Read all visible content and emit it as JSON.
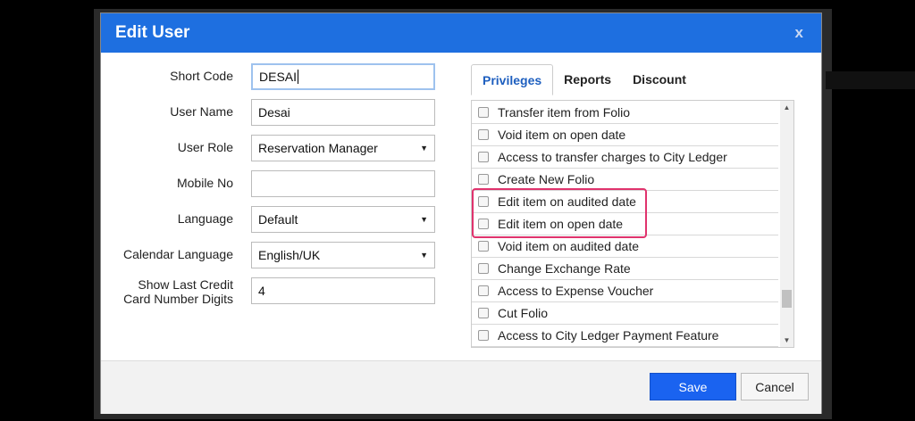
{
  "modal": {
    "title": "Edit User",
    "close_label": "x"
  },
  "form": {
    "short_code": {
      "label": "Short Code",
      "value": "DESAI"
    },
    "user_name": {
      "label": "User Name",
      "value": "Desai"
    },
    "user_role": {
      "label": "User Role",
      "value": "Reservation Manager"
    },
    "mobile_no": {
      "label": "Mobile No",
      "value": ""
    },
    "language": {
      "label": "Language",
      "value": "Default"
    },
    "calendar_language": {
      "label": "Calendar Language",
      "value": "English/UK"
    },
    "show_last_digits": {
      "label_line1": "Show Last Credit",
      "label_line2": "Card Number Digits",
      "value": "4"
    }
  },
  "tabs": [
    {
      "label": "Privileges"
    },
    {
      "label": "Reports"
    },
    {
      "label": "Discount"
    }
  ],
  "privileges": [
    "Transfer item from Folio",
    "Void item on open date",
    "Access to transfer charges to City Ledger",
    "Create New Folio",
    "Edit item on audited date",
    "Edit item on open date",
    "Void item on audited date",
    "Change Exchange Rate",
    "Access to Expense Voucher",
    "Cut Folio",
    "Access to City Ledger Payment Feature"
  ],
  "footer": {
    "save_label": "Save",
    "cancel_label": "Cancel"
  },
  "colors": {
    "header": "#1e6fe0",
    "save_button": "#1a63f0",
    "highlight": "#e0336d",
    "active_tab": "#1e5fbf"
  },
  "icons": {
    "close": "close-icon",
    "select_arrow": "chevron-down-icon",
    "checkbox": "checkbox-icon"
  }
}
